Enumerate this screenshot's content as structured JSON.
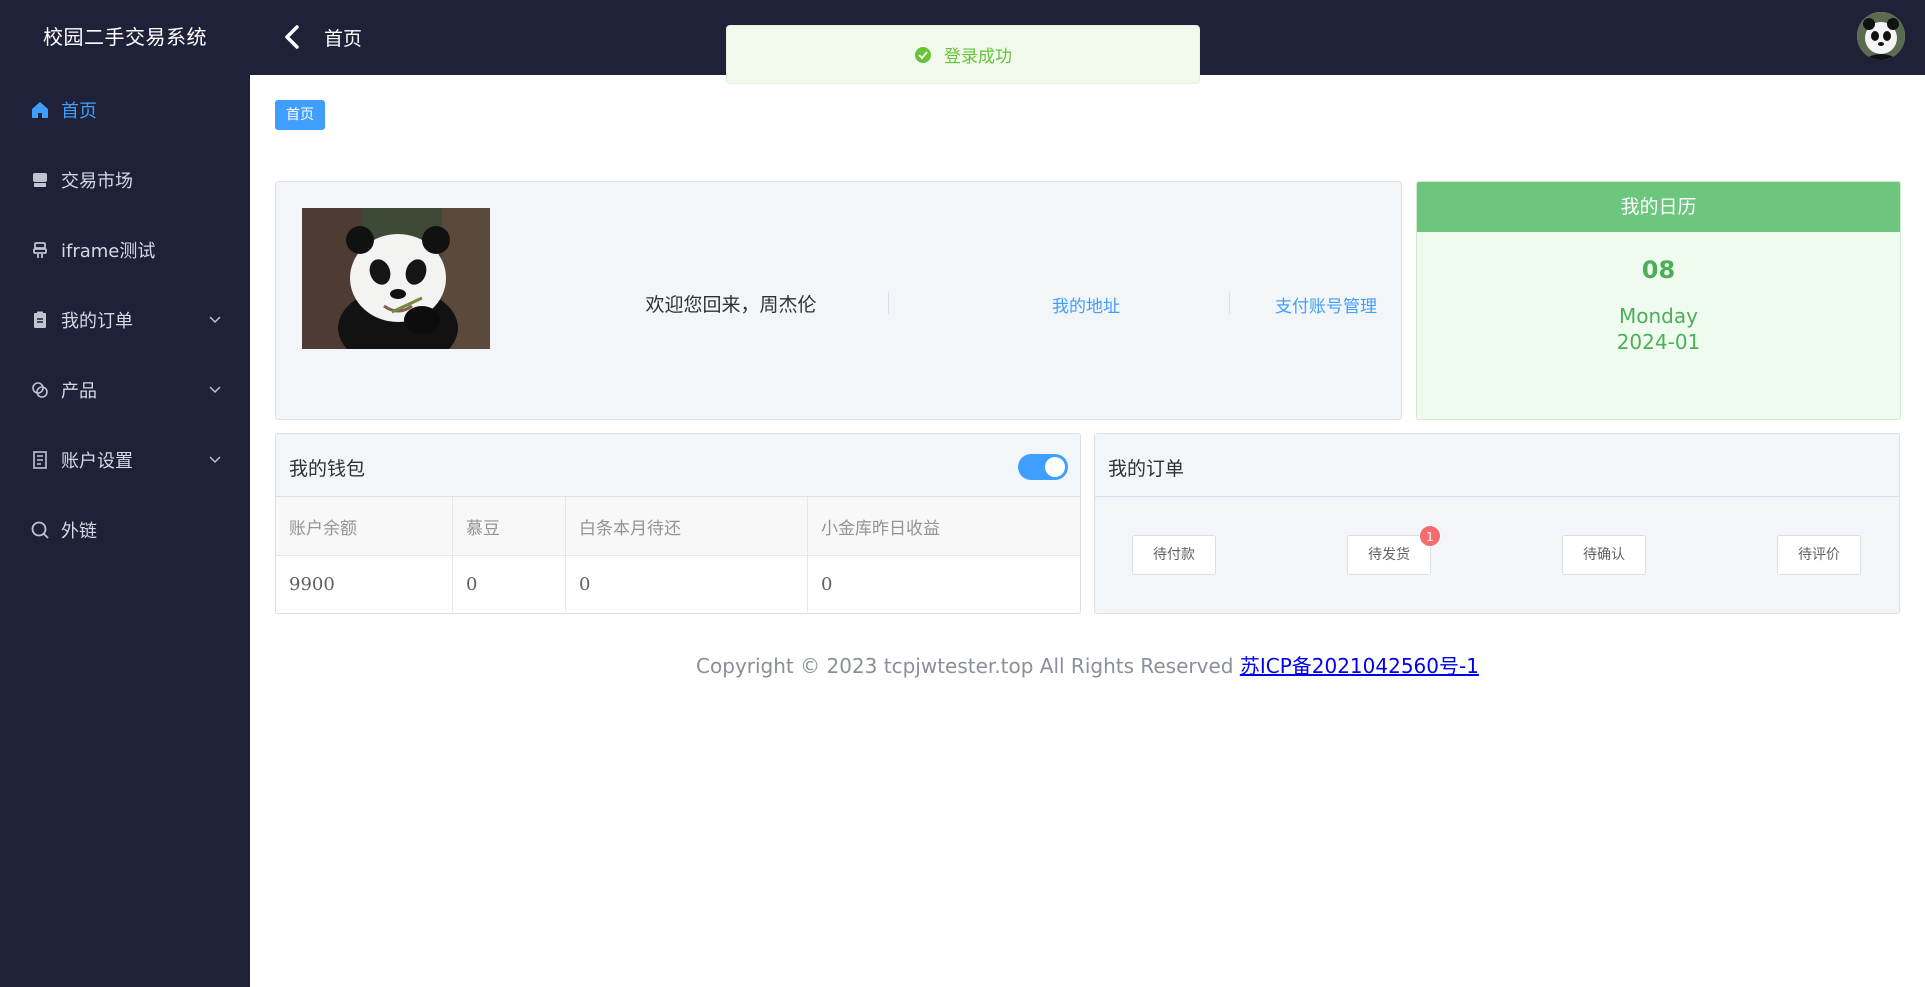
{
  "app": {
    "title": "校园二手交易系统"
  },
  "sidebar": {
    "items": [
      {
        "label": "首页",
        "icon": "home-icon",
        "active": true
      },
      {
        "label": "交易市场",
        "icon": "store-icon"
      },
      {
        "label": "iframe测试",
        "icon": "plug-icon"
      },
      {
        "label": "我的订单",
        "icon": "clipboard-icon",
        "expandable": true
      },
      {
        "label": "产品",
        "icon": "link-icon",
        "expandable": true
      },
      {
        "label": "账户设置",
        "icon": "document-icon",
        "expandable": true
      },
      {
        "label": "外链",
        "icon": "search-icon"
      }
    ]
  },
  "topbar": {
    "title": "首页"
  },
  "toast": {
    "message": "登录成功",
    "color": "#67c23a"
  },
  "breadcrumb": {
    "tag": "首页"
  },
  "user_card": {
    "welcome": "欢迎您回来，周杰伦",
    "link_address": "我的地址",
    "link_payment": "支付账号管理"
  },
  "calendar": {
    "title": "我的日历",
    "day": "08",
    "weekday": "Monday",
    "year_month": "2024-01"
  },
  "wallet": {
    "title": "我的钱包",
    "toggle_on": true,
    "columns": [
      "账户余额",
      "慕豆",
      "白条本月待还",
      "小金库昨日收益"
    ],
    "values": [
      "9900",
      "0",
      "0",
      "0"
    ]
  },
  "orders": {
    "title": "我的订单",
    "buttons": [
      {
        "label": "待付款"
      },
      {
        "label": "待发货",
        "badge": "1"
      },
      {
        "label": "待确认"
      },
      {
        "label": "待评价"
      }
    ]
  },
  "footer": {
    "copyright": "Copyright © 2023 tcpjwtester.top All Rights Reserved ",
    "icp": "苏ICP备2021042560号-1"
  },
  "colors": {
    "accent": "#409eff",
    "sidebar_bg": "#1e2138",
    "calendar_green": "#6cc67e",
    "badge_red": "#f56c6c"
  }
}
